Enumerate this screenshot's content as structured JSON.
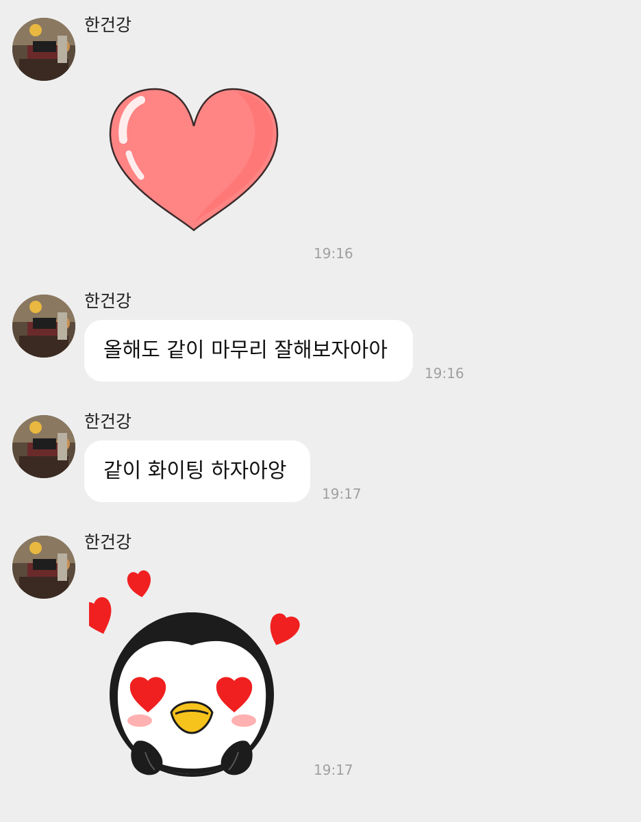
{
  "messages": [
    {
      "sender": "한건강",
      "type": "sticker",
      "sticker": "heart-sticker",
      "time": "19:16"
    },
    {
      "sender": "한건강",
      "type": "text",
      "text": "올해도 같이 마무리 잘해보자아아",
      "time": "19:16"
    },
    {
      "sender": "한건강",
      "type": "text",
      "text": "같이 화이팅 하자아앙",
      "time": "19:17"
    },
    {
      "sender": "한건강",
      "type": "sticker",
      "sticker": "penguin-heart-eyes-sticker",
      "time": "19:17"
    }
  ],
  "colors": {
    "background": "#eeeeee",
    "bubble": "#ffffff",
    "heart": "#ff8484",
    "timestamp": "#a0a0a0"
  }
}
